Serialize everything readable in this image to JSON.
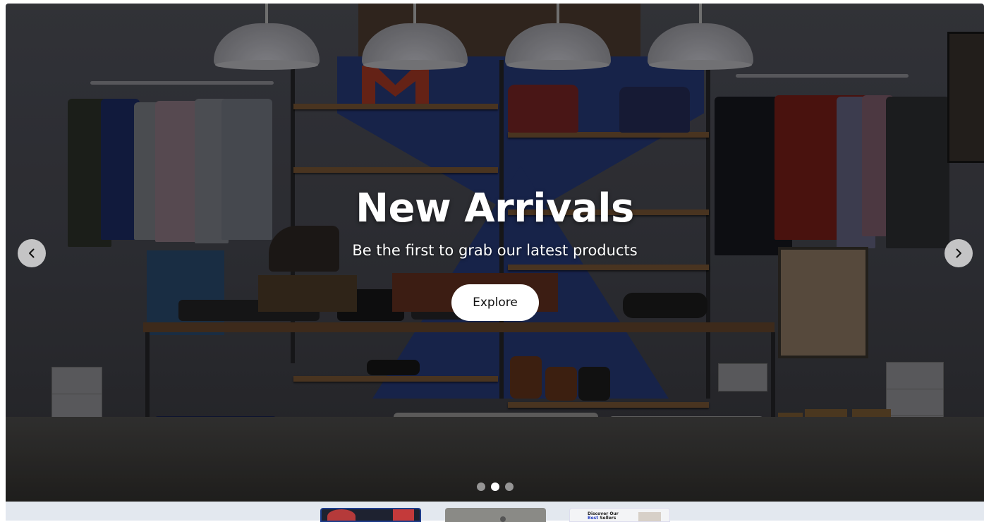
{
  "hero": {
    "title": "New Arrivals",
    "subtitle": "Be the first to grab our latest products",
    "cta_label": "Explore",
    "background_icon": "clothing-store-photo",
    "prev_icon": "chevron-left-icon",
    "next_icon": "chevron-right-icon",
    "active_slide": 2,
    "slide_count": 3
  },
  "thumbnails": {
    "items": [
      {
        "name": "thumbnail-1",
        "icon": "store-photo"
      },
      {
        "name": "thumbnail-2",
        "icon": "person-photo"
      },
      {
        "name": "thumbnail-3",
        "text_prefix": "Discover Our",
        "text_highlight": "Best",
        "text_suffix": "Sellers"
      }
    ]
  },
  "colors": {
    "accent": "#1d3c8a",
    "highlight": "#2b44c4",
    "strip_background": "#e3e8ef"
  }
}
